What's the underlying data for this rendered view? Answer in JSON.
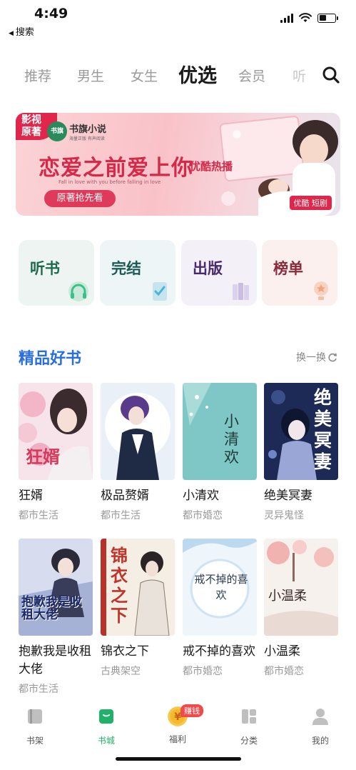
{
  "status_bar": {
    "time": "4:49",
    "back_label": "搜索"
  },
  "tabs": [
    {
      "label": "推荐"
    },
    {
      "label": "男生"
    },
    {
      "label": "女生"
    },
    {
      "label": "优选"
    },
    {
      "label": "会员"
    },
    {
      "label": "听"
    }
  ],
  "active_tab": "优选",
  "banner": {
    "badge": "影视\n原著",
    "logo_mark": "书旗",
    "logo_text": "书旗小说",
    "logo_sub": "海量正版 有声阅读",
    "title": "恋爱之前爱上你",
    "tag": "优酷热播",
    "english": "Fall in love with you before falling in love",
    "cta": "原著抢先看",
    "chip": "优酷 短剧"
  },
  "categories": [
    {
      "label": "听书",
      "color": "#1d6a4e"
    },
    {
      "label": "完结",
      "color": "#1d5a55"
    },
    {
      "label": "出版",
      "color": "#4a2a6e"
    },
    {
      "label": "榜单",
      "color": "#8a2a3a"
    }
  ],
  "section": {
    "title": "精品好书",
    "refresh": "换一换"
  },
  "books": [
    {
      "title": "狂婿",
      "genre": "都市生活",
      "cover_text": "狂婿"
    },
    {
      "title": "极品赘婿",
      "genre": "都市生活",
      "cover_text": ""
    },
    {
      "title": "小清欢",
      "genre": "都市婚恋",
      "cover_text": "小清欢"
    },
    {
      "title": "绝美冥妻",
      "genre": "灵异鬼怪",
      "cover_text": "绝美冥妻"
    },
    {
      "title": "抱歉我是收租大佬",
      "genre": "都市生活",
      "cover_text": "抱歉我是收租大佬"
    },
    {
      "title": "锦衣之下",
      "genre": "古典架空",
      "cover_text": "锦衣之下"
    },
    {
      "title": "戒不掉的喜欢",
      "genre": "都市婚恋",
      "cover_text": "戒不掉的喜欢"
    },
    {
      "title": "小温柔",
      "genre": "都市婚恋",
      "cover_text": "小温柔"
    }
  ],
  "bottom_nav": [
    {
      "label": "书架",
      "icon": "bookshelf-icon"
    },
    {
      "label": "书城",
      "icon": "bookstore-icon",
      "active": true
    },
    {
      "label": "福利",
      "icon": "coin-icon",
      "badge": "赚钱"
    },
    {
      "label": "分类",
      "icon": "category-icon"
    },
    {
      "label": "我的",
      "icon": "profile-icon"
    }
  ],
  "colors": {
    "accent": "#20b26b",
    "section_title": "#2a6fdb",
    "banner_red": "#e0264a"
  }
}
